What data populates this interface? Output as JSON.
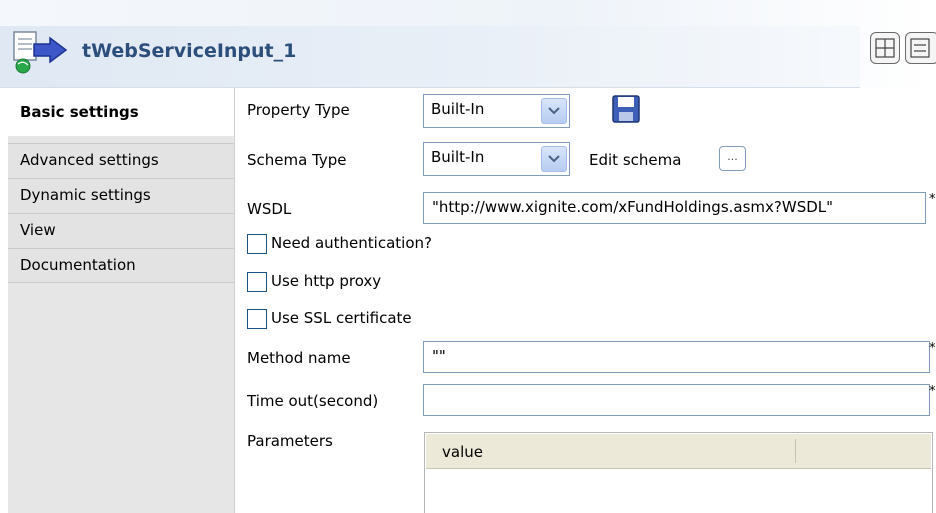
{
  "header": {
    "title": "tWebServiceInput_1",
    "icon": "web-service-component-icon"
  },
  "sidebar": {
    "tabs": [
      {
        "label": "Basic settings",
        "active": true
      },
      {
        "label": "Advanced settings",
        "active": false
      },
      {
        "label": "Dynamic settings",
        "active": false
      },
      {
        "label": "View",
        "active": false
      },
      {
        "label": "Documentation",
        "active": false
      }
    ]
  },
  "form": {
    "property_type": {
      "label": "Property Type",
      "value": "Built-In"
    },
    "schema_type": {
      "label": "Schema Type",
      "value": "Built-In",
      "edit_label": "Edit schema",
      "edit_button": "..."
    },
    "wsdl": {
      "label": "WSDL",
      "value": "\"http://www.xignite.com/xFundHoldings.asmx?WSDL\"",
      "required": "*"
    },
    "need_auth": {
      "label": "Need authentication?",
      "checked": false
    },
    "use_proxy": {
      "label": "Use http proxy",
      "checked": false
    },
    "use_ssl": {
      "label": "Use SSL certificate",
      "checked": false
    },
    "method_name": {
      "label": "Method name",
      "value": "\"\"",
      "required": "*"
    },
    "timeout": {
      "label": "Time out(second)",
      "value": "",
      "required": "*"
    },
    "parameters": {
      "label": "Parameters",
      "columns": [
        "value"
      ]
    }
  },
  "colors": {
    "title": "#2b4e7a",
    "sidebar_bg": "#e6e6e6",
    "field_border": "#7f9db9"
  }
}
